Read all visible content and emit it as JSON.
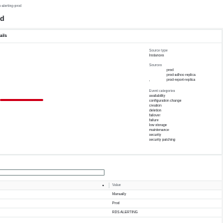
{
  "breadcrumb": {
    "current": "rds-alerting-prod"
  },
  "header": {
    "title": "d"
  },
  "details": {
    "section_title": "ails",
    "source_type": {
      "label": "Source type",
      "value": "Instances"
    },
    "sources": {
      "label": "Sources",
      "items": [
        {
          "marker": "",
          "name": "prod"
        },
        {
          "marker": "",
          "name": "prod-adhoc-replica"
        },
        {
          "marker": ",",
          "name": "prod-report-replica"
        }
      ]
    },
    "event_categories": {
      "label": "Event categories",
      "items": [
        "availability",
        "configuration change",
        "creation",
        "deletion",
        "failover",
        "failure",
        "low storage",
        "maintenance",
        "security",
        "security patching"
      ]
    }
  },
  "tags": {
    "search": {
      "value": "",
      "placeholder": ""
    },
    "table": {
      "value_header": "Value",
      "sort_icon": "▲",
      "rows": [
        {
          "value": "Manually"
        },
        {
          "value": "Prod"
        },
        {
          "value": "RDS ALERTING"
        }
      ]
    }
  },
  "colors": {
    "redaction": "#d0021b",
    "border": "#eaeded",
    "muted": "#545b64"
  }
}
